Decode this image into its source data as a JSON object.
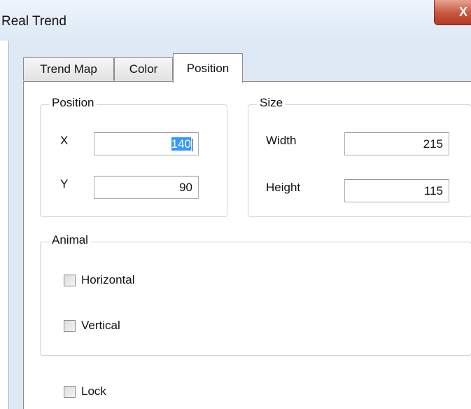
{
  "window": {
    "title": "Real Trend",
    "close_label": "X"
  },
  "tabs": [
    {
      "label": "Trend Map",
      "active": false
    },
    {
      "label": "Color",
      "active": false
    },
    {
      "label": "Position",
      "active": true
    }
  ],
  "position_group": {
    "legend": "Position",
    "x_label": "X",
    "x_value": "140",
    "y_label": "Y",
    "y_value": "90"
  },
  "size_group": {
    "legend": "Size",
    "width_label": "Width",
    "width_value": "215",
    "height_label": "Height",
    "height_value": "115"
  },
  "animal_group": {
    "legend": "Animal",
    "horizontal_label": "Horizontal",
    "horizontal_checked": false,
    "vertical_label": "Vertical",
    "vertical_checked": false
  },
  "lock": {
    "label": "Lock",
    "checked": false
  }
}
